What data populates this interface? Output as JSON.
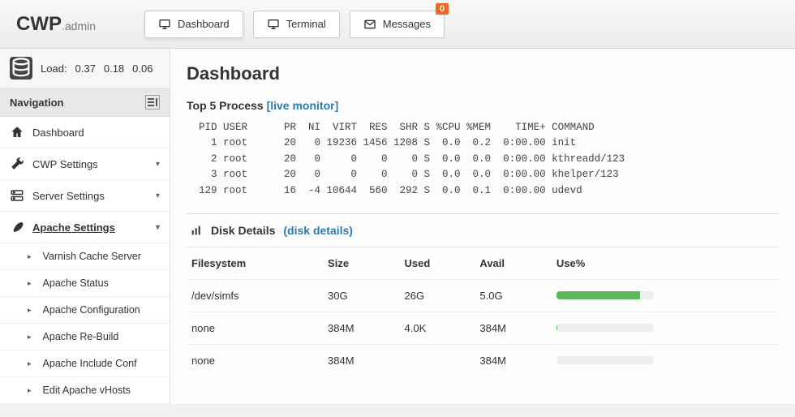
{
  "brand": {
    "main": "CWP",
    "sub": ".admin"
  },
  "topnav": {
    "dashboard": "Dashboard",
    "terminal": "Terminal",
    "messages": "Messages",
    "messages_badge": "0"
  },
  "load": {
    "label": "Load:",
    "v1": "0.37",
    "v2": "0.18",
    "v3": "0.06"
  },
  "nav_header": "Navigation",
  "nav": {
    "dashboard": "Dashboard",
    "cwp_settings": "CWP Settings",
    "server_settings": "Server Settings",
    "apache_settings": "Apache Settings"
  },
  "subnav": {
    "varnish": "Varnish Cache Server",
    "apache_status": "Apache Status",
    "apache_conf": "Apache Configuration",
    "apache_rebuild": "Apache Re-Build",
    "apache_include": "Apache Include Conf",
    "apache_vhosts": "Edit Apache vHosts"
  },
  "page_title": "Dashboard",
  "process": {
    "title": "Top 5 Process ",
    "link": "[live monitor]",
    "text": "  PID USER      PR  NI  VIRT  RES  SHR S %CPU %MEM    TIME+ COMMAND\n    1 root      20   0 19236 1456 1208 S  0.0  0.2  0:00.00 init\n    2 root      20   0     0    0    0 S  0.0  0.0  0:00.00 kthreadd/123\n    3 root      20   0     0    0    0 S  0.0  0.0  0:00.00 khelper/123\n  129 root      16  -4 10644  560  292 S  0.0  0.1  0:00.00 udevd"
  },
  "disk": {
    "title": "Disk Details ",
    "link": "(disk details)",
    "headers": {
      "fs": "Filesystem",
      "size": "Size",
      "used": "Used",
      "avail": "Avail",
      "usep": "Use%"
    },
    "rows": [
      {
        "fs": "/dev/simfs",
        "size": "30G",
        "used": "26G",
        "avail": "5.0G",
        "pct": 86
      },
      {
        "fs": "none",
        "size": "384M",
        "used": "4.0K",
        "avail": "384M",
        "pct": 1
      },
      {
        "fs": "none",
        "size": "384M",
        "used": "",
        "avail": "384M",
        "pct": 0
      }
    ]
  }
}
